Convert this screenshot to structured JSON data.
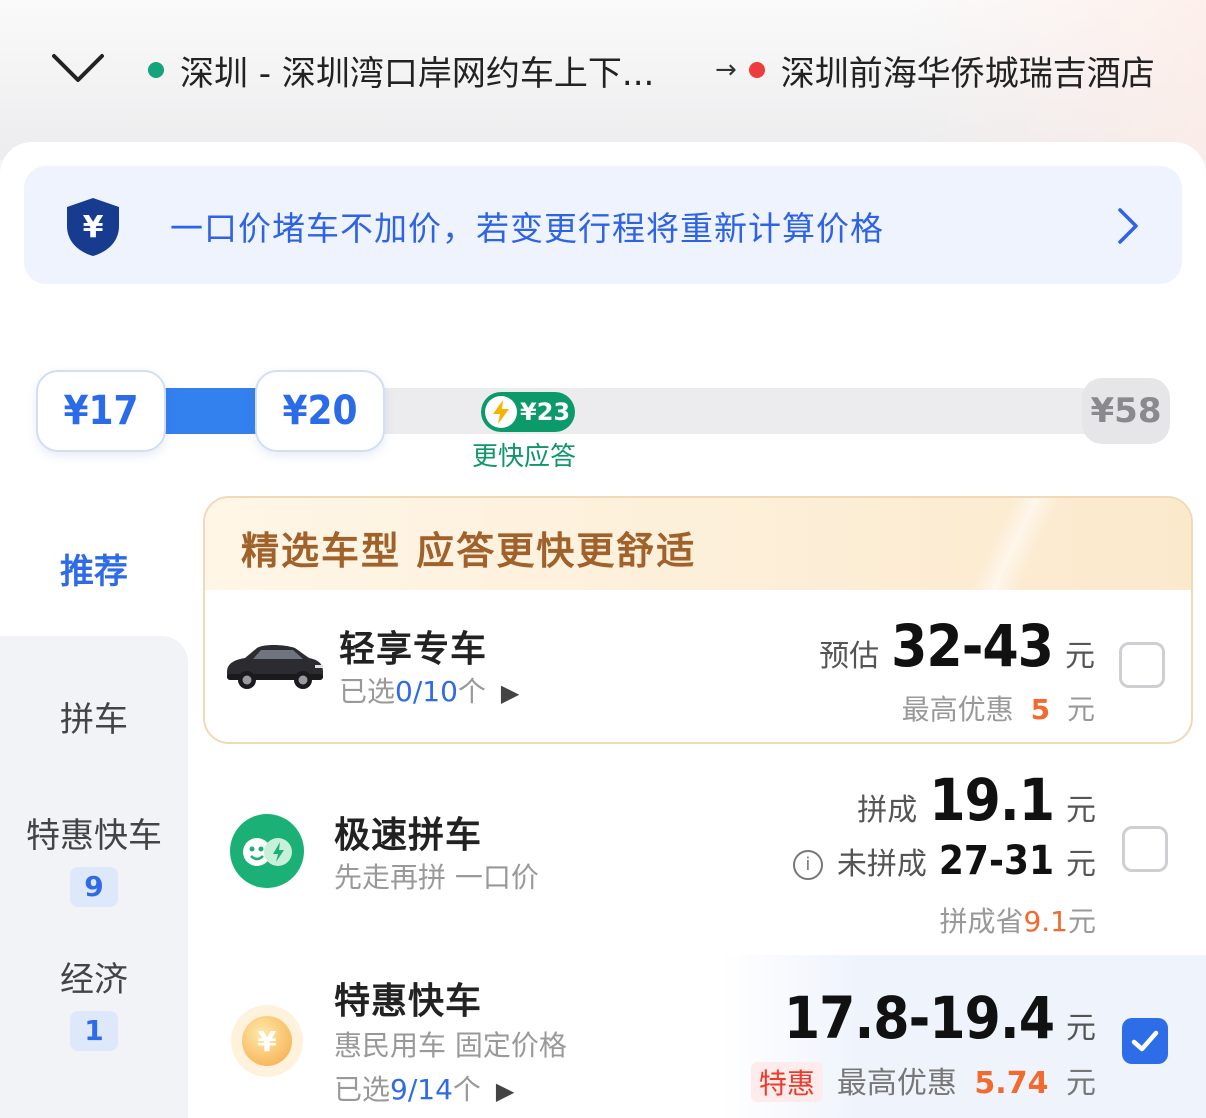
{
  "header": {
    "from": "深圳 - 深圳湾口岸网约车上下...",
    "arrow": "→",
    "to": "深圳前海华侨城瑞吉酒店"
  },
  "notice": {
    "text": "一口价堵车不加价，若变更行程将重新计算价格",
    "shield_symbol": "¥"
  },
  "price_slider": {
    "min_label": "¥17",
    "max_selected_label": "¥20",
    "fast_price": "¥23",
    "fast_label": "更快应答",
    "cap_label": "¥58"
  },
  "sidebar": {
    "recommended": "推荐",
    "items": [
      {
        "label": "拼车",
        "badge": ""
      },
      {
        "label": "特惠快车",
        "badge": "9"
      },
      {
        "label": "经济",
        "badge": "1"
      }
    ]
  },
  "featured": {
    "title": "精选车型 应答更快更舒适",
    "car": {
      "name": "轻享专车",
      "selected_prefix": "已选",
      "selected_count": "0/10",
      "selected_suffix": "个",
      "price_prefix": "预估",
      "price": "32-43",
      "unit": "元",
      "discount_prefix": "最高优惠",
      "discount": "5",
      "checked": false
    }
  },
  "carpool": {
    "name": "极速拼车",
    "subtitle": "先走再拼 一口价",
    "pooled_prefix": "拼成",
    "pooled_price": "19.1",
    "unit": "元",
    "unpooled_prefix": "未拼成",
    "unpooled_price": "27-31",
    "save_prefix": "拼成省",
    "save_amount": "9.1",
    "checked": false
  },
  "express": {
    "name": "特惠快车",
    "subtitle": "惠民用车 固定价格",
    "selected_prefix": "已选",
    "selected_count": "9/14",
    "selected_suffix": "个",
    "price": "17.8-19.4",
    "unit": "元",
    "tag": "特惠",
    "discount_prefix": "最高优惠",
    "discount": "5.74",
    "checked": true
  },
  "colors": {
    "accent": "#2f6be6",
    "green": "#0c9a6a",
    "orange": "#f26a2e",
    "gold": "#a0612a"
  }
}
